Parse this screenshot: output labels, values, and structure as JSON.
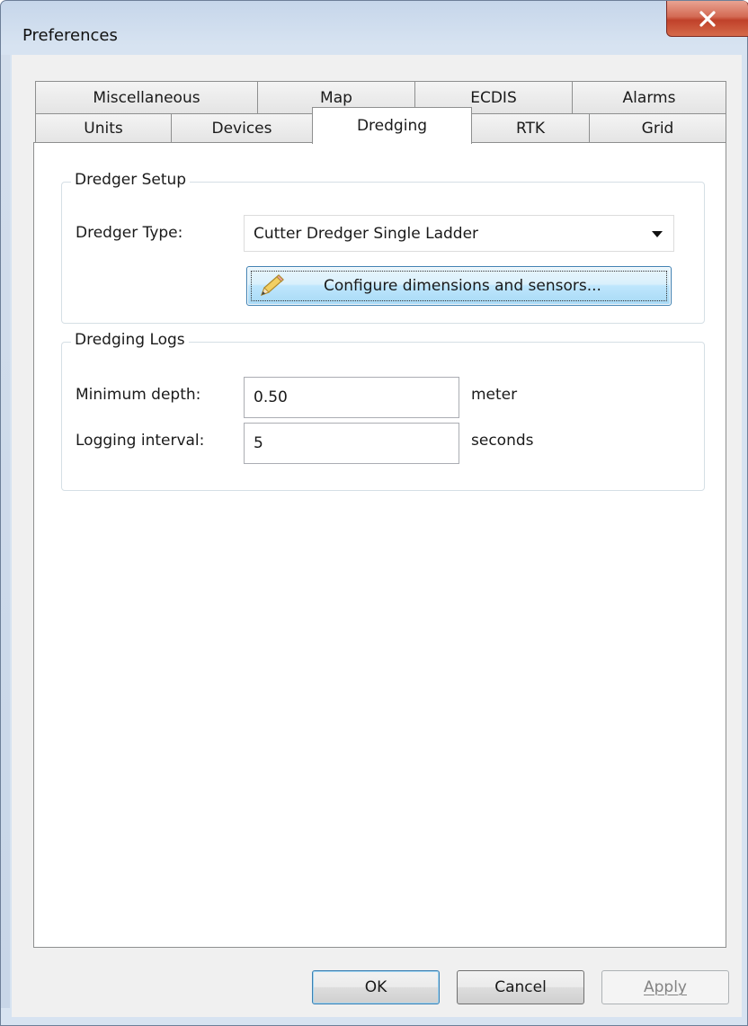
{
  "window": {
    "title": "Preferences",
    "close_icon": "close-icon"
  },
  "tabs": {
    "row_back": [
      {
        "label": "Miscellaneous"
      },
      {
        "label": "Map"
      },
      {
        "label": "ECDIS"
      },
      {
        "label": "Alarms"
      }
    ],
    "row_front": [
      {
        "label": "Units"
      },
      {
        "label": "Devices"
      },
      {
        "label": "Dredging",
        "active": true
      },
      {
        "label": "RTK"
      },
      {
        "label": "Grid"
      }
    ]
  },
  "dredger_setup": {
    "title": "Dredger Setup",
    "type_label": "Dredger Type:",
    "type_value": "Cutter Dredger Single Ladder",
    "configure_label": "Configure dimensions and sensors...",
    "configure_icon": "pencil-icon"
  },
  "dredging_logs": {
    "title": "Dredging Logs",
    "min_depth_label": "Minimum depth:",
    "min_depth_value": "0.50",
    "min_depth_unit": "meter",
    "interval_label": "Logging interval:",
    "interval_value": "5",
    "interval_unit": "seconds"
  },
  "footer": {
    "ok": "OK",
    "cancel": "Cancel",
    "apply": "Apply"
  },
  "colors": {
    "close_button": "#c8452e",
    "default_button_border": "#3c7fb1",
    "panel_border": "#8e8f8f"
  }
}
